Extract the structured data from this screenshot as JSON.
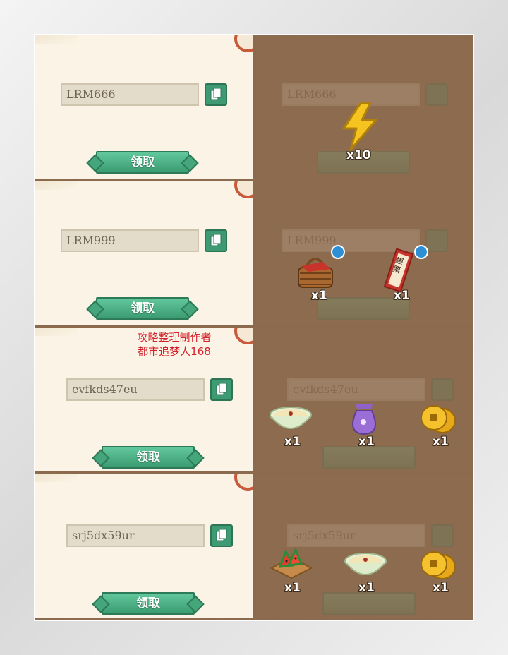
{
  "rows": [
    {
      "code": "LRM666",
      "claim_label": "领取",
      "rewards": [
        {
          "icon": "lightning-icon",
          "count": "x10"
        }
      ]
    },
    {
      "code": "LRM999",
      "claim_label": "领取",
      "rewards": [
        {
          "icon": "picnic-basket-icon",
          "count": "x1"
        },
        {
          "icon": "silver-ticket-icon",
          "count": "x1",
          "ticket_text": "銀票"
        }
      ]
    },
    {
      "code": "evfkds47eu",
      "claim_label": "领取",
      "watermark": [
        "攻略整理制作者",
        "都市追梦人168"
      ],
      "rewards": [
        {
          "icon": "porridge-bowl-icon",
          "count": "x1"
        },
        {
          "icon": "purple-pouch-icon",
          "count": "x1"
        },
        {
          "icon": "gold-coins-icon",
          "count": "x1"
        }
      ]
    },
    {
      "code": "srj5dx59ur",
      "claim_label": "领取",
      "rewards": [
        {
          "icon": "watermelon-icon",
          "count": "x1"
        },
        {
          "icon": "porridge-bowl-icon",
          "count": "x1"
        },
        {
          "icon": "gold-coins-icon",
          "count": "x1"
        }
      ]
    }
  ],
  "colors": {
    "accent_green": "#3e9a73",
    "watermark_red": "#d3222c",
    "panel_bg": "#fbf4e6",
    "overlay_brown": "#8d6b4e"
  }
}
